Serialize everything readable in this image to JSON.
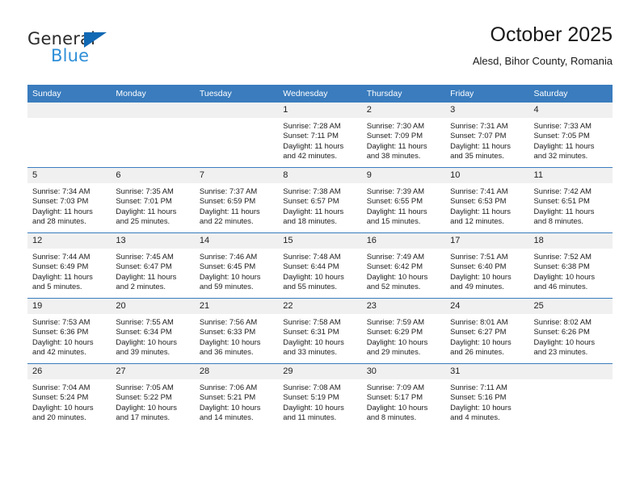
{
  "brand": {
    "name_top": "General",
    "name_bottom": "Blue",
    "triangle_color": "#1168b3",
    "blue_text_color": "#2f8fd8"
  },
  "header": {
    "title": "October 2025",
    "subtitle": "Alesd, Bihor County, Romania"
  },
  "theme": {
    "header_blue": "#3a7cbe",
    "daynum_bg": "#f0f0f0",
    "page_bg": "#ffffff"
  },
  "weekday_headers": [
    "Sunday",
    "Monday",
    "Tuesday",
    "Wednesday",
    "Thursday",
    "Friday",
    "Saturday"
  ],
  "labels": {
    "sunrise_prefix": "Sunrise:",
    "sunset_prefix": "Sunset:",
    "daylight_prefix": "Daylight:"
  },
  "weeks": [
    [
      {
        "day": "",
        "sunrise": "",
        "sunset": "",
        "daylight": ""
      },
      {
        "day": "",
        "sunrise": "",
        "sunset": "",
        "daylight": ""
      },
      {
        "day": "",
        "sunrise": "",
        "sunset": "",
        "daylight": ""
      },
      {
        "day": "1",
        "sunrise": "Sunrise: 7:28 AM",
        "sunset": "Sunset: 7:11 PM",
        "daylight": "Daylight: 11 hours and 42 minutes."
      },
      {
        "day": "2",
        "sunrise": "Sunrise: 7:30 AM",
        "sunset": "Sunset: 7:09 PM",
        "daylight": "Daylight: 11 hours and 38 minutes."
      },
      {
        "day": "3",
        "sunrise": "Sunrise: 7:31 AM",
        "sunset": "Sunset: 7:07 PM",
        "daylight": "Daylight: 11 hours and 35 minutes."
      },
      {
        "day": "4",
        "sunrise": "Sunrise: 7:33 AM",
        "sunset": "Sunset: 7:05 PM",
        "daylight": "Daylight: 11 hours and 32 minutes."
      }
    ],
    [
      {
        "day": "5",
        "sunrise": "Sunrise: 7:34 AM",
        "sunset": "Sunset: 7:03 PM",
        "daylight": "Daylight: 11 hours and 28 minutes."
      },
      {
        "day": "6",
        "sunrise": "Sunrise: 7:35 AM",
        "sunset": "Sunset: 7:01 PM",
        "daylight": "Daylight: 11 hours and 25 minutes."
      },
      {
        "day": "7",
        "sunrise": "Sunrise: 7:37 AM",
        "sunset": "Sunset: 6:59 PM",
        "daylight": "Daylight: 11 hours and 22 minutes."
      },
      {
        "day": "8",
        "sunrise": "Sunrise: 7:38 AM",
        "sunset": "Sunset: 6:57 PM",
        "daylight": "Daylight: 11 hours and 18 minutes."
      },
      {
        "day": "9",
        "sunrise": "Sunrise: 7:39 AM",
        "sunset": "Sunset: 6:55 PM",
        "daylight": "Daylight: 11 hours and 15 minutes."
      },
      {
        "day": "10",
        "sunrise": "Sunrise: 7:41 AM",
        "sunset": "Sunset: 6:53 PM",
        "daylight": "Daylight: 11 hours and 12 minutes."
      },
      {
        "day": "11",
        "sunrise": "Sunrise: 7:42 AM",
        "sunset": "Sunset: 6:51 PM",
        "daylight": "Daylight: 11 hours and 8 minutes."
      }
    ],
    [
      {
        "day": "12",
        "sunrise": "Sunrise: 7:44 AM",
        "sunset": "Sunset: 6:49 PM",
        "daylight": "Daylight: 11 hours and 5 minutes."
      },
      {
        "day": "13",
        "sunrise": "Sunrise: 7:45 AM",
        "sunset": "Sunset: 6:47 PM",
        "daylight": "Daylight: 11 hours and 2 minutes."
      },
      {
        "day": "14",
        "sunrise": "Sunrise: 7:46 AM",
        "sunset": "Sunset: 6:45 PM",
        "daylight": "Daylight: 10 hours and 59 minutes."
      },
      {
        "day": "15",
        "sunrise": "Sunrise: 7:48 AM",
        "sunset": "Sunset: 6:44 PM",
        "daylight": "Daylight: 10 hours and 55 minutes."
      },
      {
        "day": "16",
        "sunrise": "Sunrise: 7:49 AM",
        "sunset": "Sunset: 6:42 PM",
        "daylight": "Daylight: 10 hours and 52 minutes."
      },
      {
        "day": "17",
        "sunrise": "Sunrise: 7:51 AM",
        "sunset": "Sunset: 6:40 PM",
        "daylight": "Daylight: 10 hours and 49 minutes."
      },
      {
        "day": "18",
        "sunrise": "Sunrise: 7:52 AM",
        "sunset": "Sunset: 6:38 PM",
        "daylight": "Daylight: 10 hours and 46 minutes."
      }
    ],
    [
      {
        "day": "19",
        "sunrise": "Sunrise: 7:53 AM",
        "sunset": "Sunset: 6:36 PM",
        "daylight": "Daylight: 10 hours and 42 minutes."
      },
      {
        "day": "20",
        "sunrise": "Sunrise: 7:55 AM",
        "sunset": "Sunset: 6:34 PM",
        "daylight": "Daylight: 10 hours and 39 minutes."
      },
      {
        "day": "21",
        "sunrise": "Sunrise: 7:56 AM",
        "sunset": "Sunset: 6:33 PM",
        "daylight": "Daylight: 10 hours and 36 minutes."
      },
      {
        "day": "22",
        "sunrise": "Sunrise: 7:58 AM",
        "sunset": "Sunset: 6:31 PM",
        "daylight": "Daylight: 10 hours and 33 minutes."
      },
      {
        "day": "23",
        "sunrise": "Sunrise: 7:59 AM",
        "sunset": "Sunset: 6:29 PM",
        "daylight": "Daylight: 10 hours and 29 minutes."
      },
      {
        "day": "24",
        "sunrise": "Sunrise: 8:01 AM",
        "sunset": "Sunset: 6:27 PM",
        "daylight": "Daylight: 10 hours and 26 minutes."
      },
      {
        "day": "25",
        "sunrise": "Sunrise: 8:02 AM",
        "sunset": "Sunset: 6:26 PM",
        "daylight": "Daylight: 10 hours and 23 minutes."
      }
    ],
    [
      {
        "day": "26",
        "sunrise": "Sunrise: 7:04 AM",
        "sunset": "Sunset: 5:24 PM",
        "daylight": "Daylight: 10 hours and 20 minutes."
      },
      {
        "day": "27",
        "sunrise": "Sunrise: 7:05 AM",
        "sunset": "Sunset: 5:22 PM",
        "daylight": "Daylight: 10 hours and 17 minutes."
      },
      {
        "day": "28",
        "sunrise": "Sunrise: 7:06 AM",
        "sunset": "Sunset: 5:21 PM",
        "daylight": "Daylight: 10 hours and 14 minutes."
      },
      {
        "day": "29",
        "sunrise": "Sunrise: 7:08 AM",
        "sunset": "Sunset: 5:19 PM",
        "daylight": "Daylight: 10 hours and 11 minutes."
      },
      {
        "day": "30",
        "sunrise": "Sunrise: 7:09 AM",
        "sunset": "Sunset: 5:17 PM",
        "daylight": "Daylight: 10 hours and 8 minutes."
      },
      {
        "day": "31",
        "sunrise": "Sunrise: 7:11 AM",
        "sunset": "Sunset: 5:16 PM",
        "daylight": "Daylight: 10 hours and 4 minutes."
      },
      {
        "day": "",
        "sunrise": "",
        "sunset": "",
        "daylight": ""
      }
    ]
  ]
}
